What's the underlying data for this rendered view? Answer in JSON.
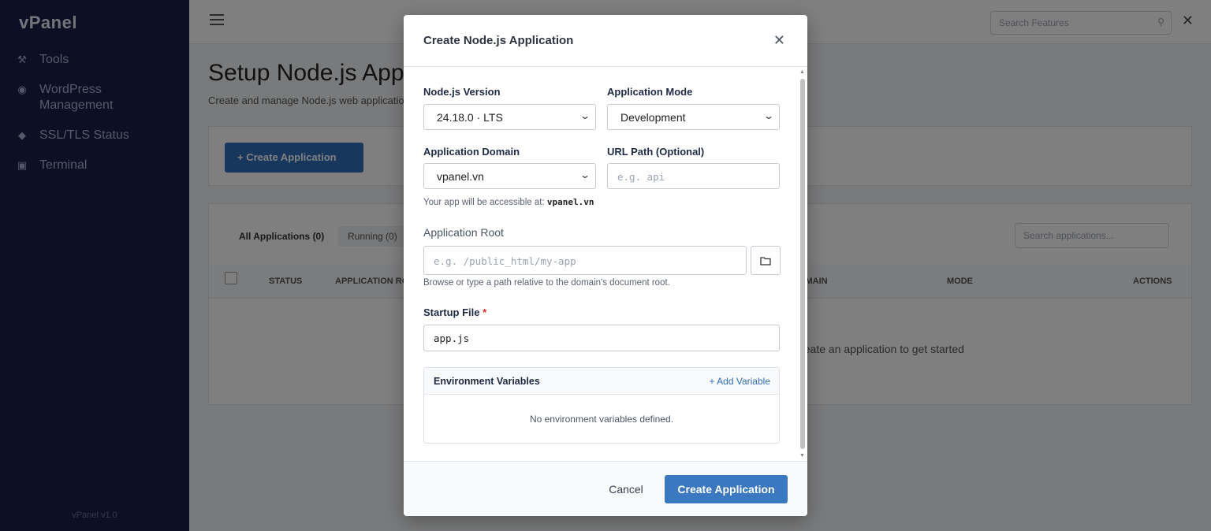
{
  "background": {
    "logo": "vPanel",
    "sidebar": {
      "items": [
        {
          "label": "Tools",
          "icon": "wrench-icon"
        },
        {
          "label": "WordPress Management",
          "icon": "wordpress-icon"
        },
        {
          "label": "SSL/TLS Status",
          "icon": "lock-icon"
        },
        {
          "label": "Terminal",
          "icon": "terminal-icon"
        }
      ],
      "footer": "vPanel v1.0"
    },
    "topbar": {
      "search_placeholder": "Search Features"
    },
    "page": {
      "title": "Setup Node.js App",
      "subtitle": "Create and manage Node.js web applications",
      "create_button": "+ Create Application",
      "tabs": [
        "All Applications (0)",
        "Running (0)"
      ],
      "search_placeholder": "Search applications...",
      "columns": [
        "STATUS",
        "APPLICATION ROOT",
        "DOMAIN",
        "MODE",
        "ACTIONS"
      ],
      "empty_text": "Create an application to get started"
    }
  },
  "modal": {
    "title": "Create Node.js Application",
    "close_glyph": "✕",
    "nodejs_version": {
      "label": "Node.js Version",
      "value": "24.18.0 · LTS"
    },
    "app_mode": {
      "label": "Application Mode",
      "value": "Development"
    },
    "app_domain": {
      "label": "Application Domain",
      "value": "vpanel.vn"
    },
    "url_path": {
      "label": "URL Path (Optional)",
      "placeholder": "e.g. api"
    },
    "accessible_prefix": "Your app will be accessible at: ",
    "accessible_url": "vpanel.vn",
    "app_root": {
      "label": "Application Root",
      "placeholder": "e.g. /public_html/my-app",
      "help": "Browse or type a path relative to the domain's document root."
    },
    "startup_file": {
      "label": "Startup File",
      "required_mark": "*",
      "value": "app.js"
    },
    "env": {
      "title": "Environment Variables",
      "add_label": "+ Add Variable",
      "empty": "No environment variables defined."
    },
    "footer": {
      "cancel": "Cancel",
      "create": "Create Application"
    }
  },
  "colors": {
    "primary": "#3a78c2",
    "sidebar": "#1a1f4b",
    "required": "#dc2626",
    "link": "#2f6fb8"
  }
}
